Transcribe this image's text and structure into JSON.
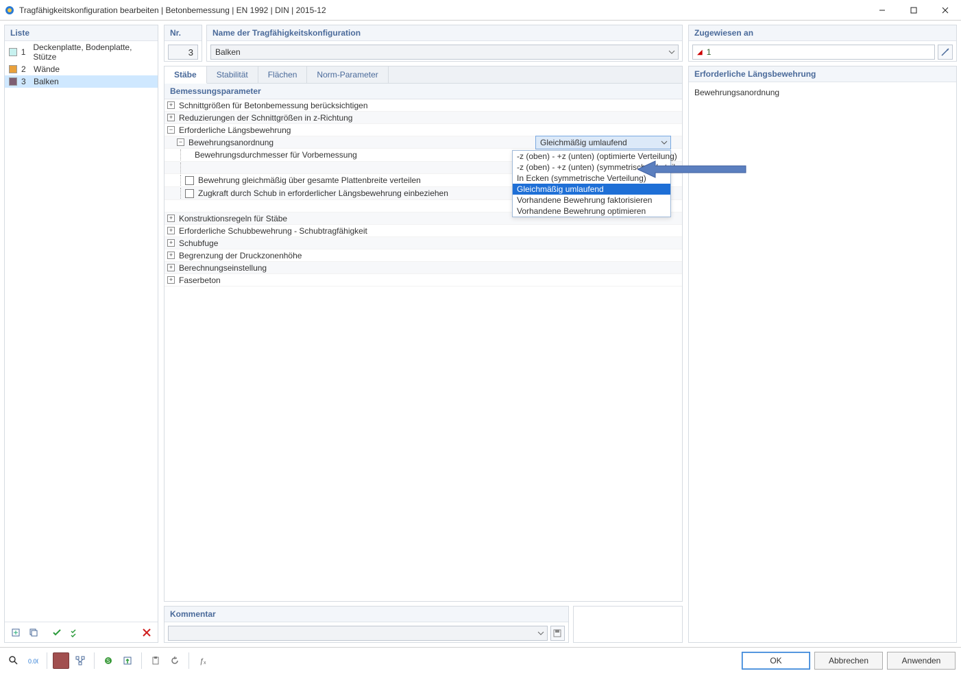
{
  "window": {
    "title": "Tragfähigkeitskonfiguration bearbeiten | Betonbemessung | EN 1992 | DIN | 2015-12"
  },
  "left": {
    "header": "Liste",
    "items": [
      {
        "num": "1",
        "label": "Deckenplatte, Bodenplatte, Stütze",
        "color": "#c7f1ef"
      },
      {
        "num": "2",
        "label": "Wände",
        "color": "#e9a13b"
      },
      {
        "num": "3",
        "label": "Balken",
        "color": "#7d5e72"
      }
    ],
    "selected_index": 2
  },
  "nr": {
    "header": "Nr.",
    "value": "3"
  },
  "name": {
    "header": "Name der Tragfähigkeitskonfiguration",
    "value": "Balken"
  },
  "assigned": {
    "header": "Zugewiesen an",
    "value": "1"
  },
  "tabs": {
    "items": [
      "Stäbe",
      "Stabilität",
      "Flächen",
      "Norm-Parameter"
    ],
    "active": 0
  },
  "params": {
    "header": "Bemessungsparameter",
    "rows": [
      "Schnittgrößen für Betonbemessung berücksichtigen",
      "Reduzierungen der Schnittgrößen in z-Richtung",
      "Erforderliche Längsbewehrung"
    ],
    "sub1": "Bewehrungsanordnung",
    "sub2": "Bewehrungsdurchmesser für Vorbemessung",
    "check1": "Bewehrung gleichmäßig über gesamte Plattenbreite verteilen",
    "check2": "Zugkraft durch Schub in erforderlicher Längsbewehrung einbeziehen",
    "after": [
      "Konstruktionsregeln für Stäbe",
      "Erforderliche Schubbewehrung - Schubtragfähigkeit",
      "Schubfuge",
      "Begrenzung der Druckzonenhöhe",
      "Berechnungseinstellung",
      "Faserbeton"
    ]
  },
  "combo": {
    "selected": "Gleichmäßig umlaufend",
    "options": [
      "-z (oben) - +z (unten) (optimierte Verteilung)",
      "-z (oben) - +z (unten) (symmetrische Verteilung)",
      "In Ecken (symmetrische Verteilung)",
      "Gleichmäßig umlaufend",
      "Vorhandene Bewehrung faktorisieren",
      "Vorhandene Bewehrung optimieren"
    ],
    "highlight_index": 3
  },
  "detail": {
    "header": "Erforderliche Längsbewehrung",
    "body": "Bewehrungsanordnung"
  },
  "kommentar": {
    "header": "Kommentar",
    "value": ""
  },
  "buttons": {
    "ok": "OK",
    "cancel": "Abbrechen",
    "apply": "Anwenden"
  }
}
